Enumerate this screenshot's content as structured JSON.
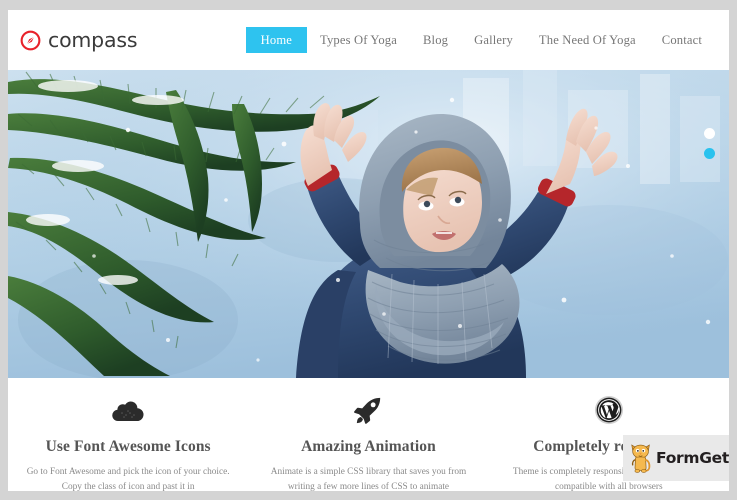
{
  "site": {
    "brand_name": "compass",
    "brand_icon": "compass-icon",
    "brand_icon_color": "#e8222a"
  },
  "nav": {
    "items": [
      {
        "label": "Home",
        "active": true
      },
      {
        "label": "Types Of Yoga",
        "active": false
      },
      {
        "label": "Blog",
        "active": false
      },
      {
        "label": "Gallery",
        "active": false
      },
      {
        "label": "The Need Of Yoga",
        "active": false
      },
      {
        "label": "Contact",
        "active": false
      }
    ],
    "active_bg_color": "#2ec3ef",
    "link_color": "#777777"
  },
  "hero": {
    "alt": "Child in a blue winter coat and grey knit scarf reaching toward a snow covered pine branch",
    "dots": [
      {
        "name": "slide-1",
        "active": false
      },
      {
        "name": "slide-2",
        "active": true
      }
    ],
    "active_dot_color": "#29c2ee"
  },
  "features": [
    {
      "icon": "cloud-icon",
      "title": "Use Font Awesome Icons",
      "text": "Go to Font Awesome and pick the icon of your choice. Copy the class of icon and past it in"
    },
    {
      "icon": "rocket-icon",
      "title": "Amazing Animation",
      "text": "Animate is a simple CSS library that saves you from writing a few more lines of CSS to animate"
    },
    {
      "icon": "wordpress-icon",
      "title": "Completely responsive",
      "text": "Theme is completely responsive, SEO Friendly and compatible with all browsers"
    }
  ],
  "watermark": {
    "text": "FormGet",
    "mascot": "cat-mascot-icon",
    "background": "#e9e9e9"
  }
}
